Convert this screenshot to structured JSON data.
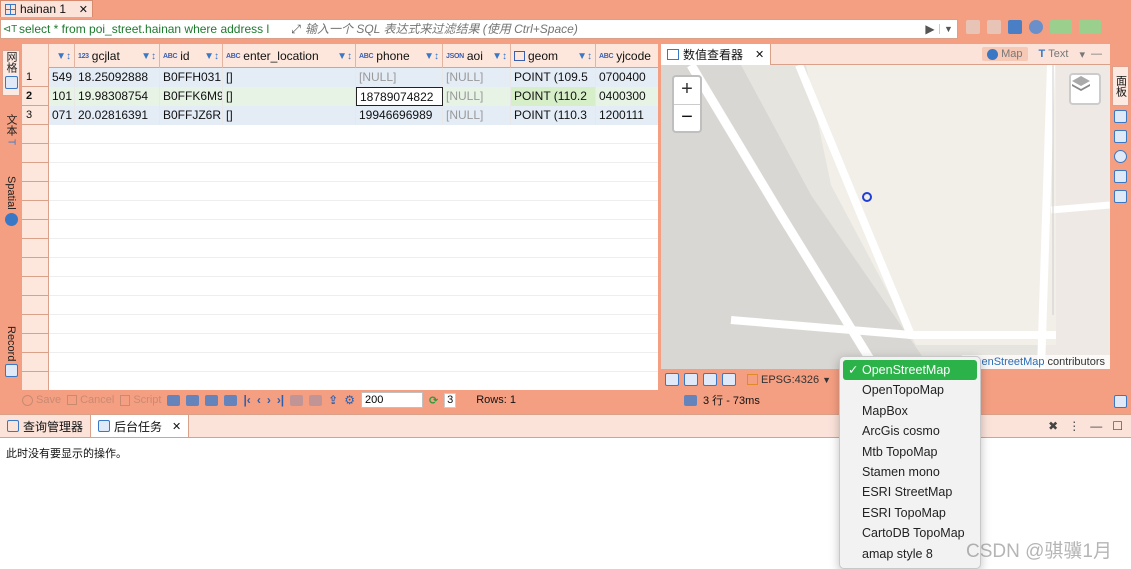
{
  "editor_tab": {
    "title": "hainan 1"
  },
  "filter_bar": {
    "sql": "select * from poi_street.hainan where address l",
    "placeholder": "输入一个 SQL 表达式来过滤结果 (使用 Ctrl+Space)"
  },
  "left_strip": {
    "grid": "网格",
    "text": "文本",
    "spatial": "Spatial",
    "record": "Record"
  },
  "grid": {
    "columns": [
      {
        "name": "",
        "type": ""
      },
      {
        "name": "gcjlat",
        "type": "123"
      },
      {
        "name": "id",
        "type": "ABC"
      },
      {
        "name": "enter_location",
        "type": "ABC"
      },
      {
        "name": "phone",
        "type": "ABC"
      },
      {
        "name": "aoi",
        "type": "JSON"
      },
      {
        "name": "geom",
        "type": ""
      },
      {
        "name": "yjcode",
        "type": "ABC"
      }
    ],
    "rows": [
      {
        "num": "1",
        "c0": "549",
        "gcjlat": "18.25092888",
        "id": "B0FFH031",
        "enter_location": "[]",
        "phone": "[NULL]",
        "aoi": "[NULL]",
        "geom": "POINT (109.5",
        "yjcode": "0700400"
      },
      {
        "num": "2",
        "c0": "101",
        "gcjlat": "19.98308754",
        "id": "B0FFK6M9",
        "enter_location": "[]",
        "phone": "18789074822",
        "aoi": "[NULL]",
        "geom": "POINT (110.2",
        "yjcode": "0400300"
      },
      {
        "num": "3",
        "c0": "071",
        "gcjlat": "20.02816391",
        "id": "B0FFJZ6R",
        "enter_location": "[]",
        "phone": "19946696989",
        "aoi": "[NULL]",
        "geom": "POINT (110.3",
        "yjcode": "1200111"
      }
    ]
  },
  "viewer": {
    "tab_title": "数值查看器",
    "map_label": "Map",
    "text_label": "Text",
    "attribution_link": "OpenStreetMap",
    "attribution_rest": " contributors",
    "epsg": "EPSG:4326"
  },
  "right_strip": {
    "panel_label": "面板"
  },
  "bottom_toolbar": {
    "save": "Save",
    "cancel": "Cancel",
    "script": "Script",
    "fetch_size": "200",
    "refresh_count": "3",
    "rows": "Rows: 1",
    "result_info": "3 行 - 73ms"
  },
  "bottom_panel": {
    "tab_query_manager": "查询管理器",
    "tab_background_tasks": "后台任务",
    "empty_message": "此时没有要显示的操作。"
  },
  "basemap_menu": {
    "items": [
      "OpenStreetMap",
      "OpenTopoMap",
      "MapBox",
      "ArcGis cosmo",
      "Mtb TopoMap",
      "Stamen mono",
      "ESRI StreetMap",
      "ESRI TopoMap",
      "CartoDB TopoMap",
      "amap style 8"
    ],
    "selected": "OpenStreetMap"
  },
  "watermark": "CSDN @骐骥1月",
  "colors": {
    "accent_bg": "#f59f82",
    "selected_green": "#2bb34a",
    "sql_green": "#1d7b2d",
    "marker_blue": "#1f3fd6"
  }
}
